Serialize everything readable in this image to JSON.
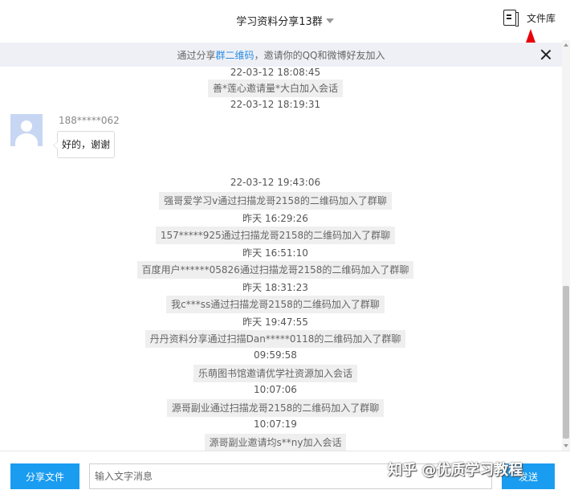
{
  "header": {
    "title": "学习资料分享13群",
    "file_library_label": "文件库"
  },
  "notice": {
    "prefix": "通过分享 ",
    "link": "群二维码",
    "suffix": "，邀请你的QQ和微博好友加入"
  },
  "messages": {
    "time_1": "22-03-12  18:08:45",
    "sys_1": "善*莲心邀请量*大白加入会话",
    "time_2": "22-03-12  18:19:31",
    "chat_sender": "188*****062",
    "chat_text": "好的，谢谢",
    "time_3": "22-03-12  19:43:06",
    "sys_2": "强哥爱学习v通过扫描龙哥2158的二维码加入了群聊",
    "time_4": "昨天  16:29:26",
    "sys_3": "157*****925通过扫描龙哥2158的二维码加入了群聊",
    "time_5": "昨天  16:51:10",
    "sys_4": "百度用户******05826通过扫描龙哥2158的二维码加入了群聊",
    "time_6": "昨天  18:31:23",
    "sys_5": "我c***ss通过扫描龙哥2158的二维码加入了群聊",
    "time_7": "昨天  19:47:55",
    "sys_6": "丹丹资料分享通过扫描Dan*****0118的二维码加入了群聊",
    "time_8": "09:59:58",
    "sys_7": "乐萌图书馆邀请优学社资源加入会话",
    "time_9": "10:07:06",
    "sys_8": "源哥副业通过扫描龙哥2158的二维码加入了群聊",
    "time_10": "10:07:19",
    "sys_9": "源哥副业邀请均s**ny加入会话"
  },
  "input": {
    "share_file_label": "分享文件",
    "placeholder": "输入文字消息",
    "send_label": "发送"
  },
  "watermark": "知乎 @优质学习教程",
  "colors": {
    "accent": "#1a9cf0",
    "notice_bg": "#eef0f5",
    "link": "#2a8ce6",
    "annotation_arrow": "#e8000b"
  },
  "icons": [
    "chevron-down-icon",
    "file-library-icon",
    "close-icon",
    "avatar-placeholder-icon",
    "red-arrow-annotation"
  ]
}
